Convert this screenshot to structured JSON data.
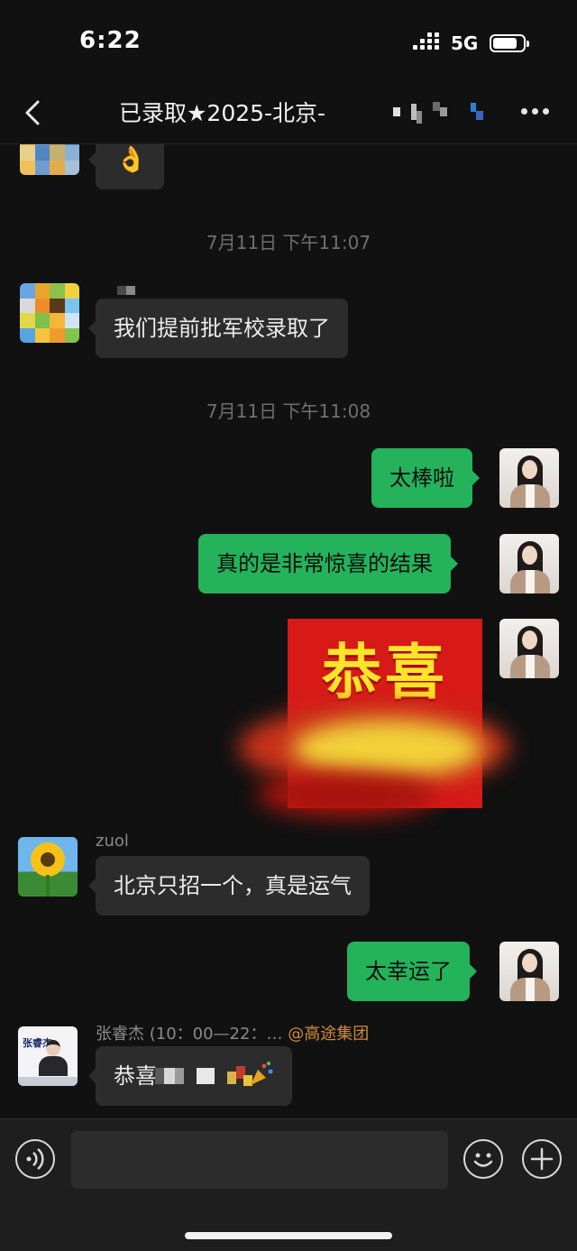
{
  "status_bar": {
    "time": "6:22",
    "network": "5G"
  },
  "nav": {
    "title": "已录取★2025-北京-"
  },
  "chat": {
    "timestamps": [
      "7月11日 下午11:07",
      "7月11日 下午11:08"
    ],
    "messages": [
      {
        "dir": "in",
        "text": "👌"
      },
      {
        "dir": "in",
        "text": "我们提前批军校录取了"
      },
      {
        "dir": "out",
        "text": "太棒啦"
      },
      {
        "dir": "out",
        "text": "真的是非常惊喜的结果"
      },
      {
        "dir": "out",
        "sticker_text": "恭喜"
      },
      {
        "dir": "in",
        "sender": "zuol",
        "text": "北京只招一个，真是运气"
      },
      {
        "dir": "out",
        "text": "太幸运了"
      },
      {
        "dir": "in",
        "sender": "张睿杰 (10：00—22：…",
        "sender_org": "@高途集团",
        "text": "恭喜"
      }
    ],
    "card_avatar_label": "张睿杰"
  },
  "colors": {
    "background": "#111111",
    "bubble_in": "#2c2c2c",
    "bubble_out": "#24b35a",
    "org_tag": "#d08a3c"
  },
  "icons": {
    "back": "chevron-left-icon",
    "more": "more-dots-icon",
    "voice": "voice-icon",
    "emoji": "emoji-icon",
    "plus": "plus-icon"
  }
}
